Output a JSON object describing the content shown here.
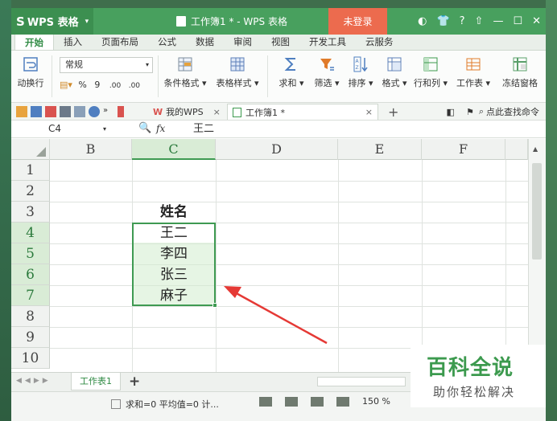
{
  "titlebar": {
    "app_name": "WPS 表格",
    "document_title": "工作簿1 * - WPS 表格",
    "login_label": "未登录",
    "help_label": "?"
  },
  "menu": {
    "tabs": [
      "开始",
      "插入",
      "页面布局",
      "公式",
      "数据",
      "审阅",
      "视图",
      "开发工具",
      "云服务"
    ],
    "active_tab": "开始"
  },
  "ribbon": {
    "wrap_label": "动换行",
    "number_format": "常规",
    "percent_label": "%",
    "comma_label": "9",
    "dec_inc_label": ".00",
    "dec_dec_label": ".00",
    "cond_format_label": "条件格式 ▾",
    "table_style_label": "表格样式 ▾",
    "sum_label": "求和 ▾",
    "filter_label": "筛选 ▾",
    "sort_label": "排序 ▾",
    "format_label": "格式 ▾",
    "rowcol_label": "行和列 ▾",
    "sheet_label": "工作表 ▾",
    "freeze_label": "冻结窗格"
  },
  "quickbar": {
    "home_tab": "我的WPS",
    "doc_tab": "工作簿1 *",
    "close_glyph": "×",
    "add_glyph": "+",
    "search_hint": "点此查找命令"
  },
  "formula_bar": {
    "cell_ref": "C4",
    "fx_label": "fx",
    "content": "王二"
  },
  "columns": [
    "B",
    "C",
    "D",
    "E",
    "F"
  ],
  "selected_column": "C",
  "rows": [
    "1",
    "2",
    "3",
    "4",
    "5",
    "6",
    "7",
    "8",
    "9",
    "10"
  ],
  "selected_rows": [
    "4",
    "5",
    "6",
    "7"
  ],
  "cells": {
    "C3": "姓名",
    "C4": "王二",
    "C5": "李四",
    "C6": "张三",
    "C7": "麻子"
  },
  "sheets": {
    "tabs": [
      "工作表1"
    ],
    "add_label": "+"
  },
  "status": {
    "summary": "求和=0 平均值=0 计...",
    "zoom": "150 %"
  },
  "watermark": {
    "title": "百科全说",
    "subtitle": "助你轻松解决"
  }
}
